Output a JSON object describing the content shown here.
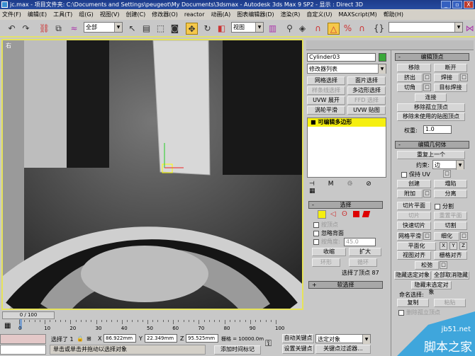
{
  "window": {
    "title": "jc.max   - 项目文件夹: C:\\Documents and Settings\\peugeot\\My Documents\\3dsmax    - Autodesk 3ds Max 9 SP2    - 显示 : Direct 3D",
    "buttons": [
      "_",
      "▫",
      "X"
    ]
  },
  "menu": [
    "文件(F)",
    "编辑(E)",
    "工具(T)",
    "组(G)",
    "视图(V)",
    "创建(C)",
    "修改器(O)",
    "reactor",
    "动画(A)",
    "图表编辑器(D)",
    "渲染(R)",
    "自定义(U)",
    "MAXScript(M)",
    "帮助(H)"
  ],
  "toolbar": {
    "selection_filter": "全部",
    "ref_coord": "视图",
    "named_sel": ""
  },
  "viewport": {
    "label": "右"
  },
  "command_panel": {
    "object_name": "Cylinder03",
    "object_color": "#3aa83a",
    "modifier_list": "修改器列表",
    "modifier_buttons": [
      {
        "label": "网格选择",
        "enabled": true
      },
      {
        "label": "面片选择",
        "enabled": true
      },
      {
        "label": "样条线选择",
        "enabled": false
      },
      {
        "label": "多边形选择",
        "enabled": true
      },
      {
        "label": "UVW 展开",
        "enabled": true
      },
      {
        "label": "FFD 选择",
        "enabled": false
      },
      {
        "label": "涡轮平滑",
        "enabled": true
      },
      {
        "label": "UVW 贴图",
        "enabled": true
      }
    ],
    "stack_item": "可编辑多边形",
    "selection": {
      "title": "选择",
      "by_vertex": "按顶点",
      "ignore_backfacing": "忽略背面",
      "by_angle": "按角度:",
      "angle_value": "45.0",
      "shrink": "收缩",
      "grow": "扩大",
      "ring": "环形",
      "loop": "循环",
      "status": "选择了顶点 87"
    },
    "soft_selection": {
      "title": "软选择"
    },
    "edit_vertices": {
      "title": "编辑顶点",
      "buttons": [
        "移除",
        "断开",
        "挤出",
        "焊接",
        "切角",
        "目标焊接",
        "连接",
        "移除孤立顶点",
        "移除未使用的贴图顶点"
      ],
      "weight_label": "权重:",
      "weight_value": "1.0"
    },
    "edit_geometry": {
      "title": "编辑几何体",
      "repeat": "重复上一个",
      "constraint_label": "约束:",
      "constraint_value": "边",
      "preserve_uv": "保持 UV",
      "create": "创建",
      "collapse": "塌陷",
      "attach": "附加",
      "detach": "分离",
      "slice_plane": "切片平面",
      "split": "分割",
      "slice": "切片",
      "reset_plane": "重置平面",
      "quickslice": "快速切片",
      "cut": "切割",
      "meshsmooth": "网格平滑",
      "tessellate": "细化",
      "make_planar": "平面化",
      "x": "X",
      "y": "Y",
      "z": "Z",
      "view_align": "视图对齐",
      "grid_align": "栅格对齐",
      "relax": "松弛",
      "hide_selected": "隐藏选定对象",
      "unhide_all": "全部取消隐藏",
      "hide_unselected": "隐藏未选定对象",
      "named_sel": "命名选择:",
      "copy": "复制",
      "paste": "粘贴",
      "delete_isolated": "删除孤立顶点"
    }
  },
  "timeline": {
    "slider": "0 / 100",
    "ticks": [
      "0",
      "10",
      "20",
      "30",
      "40",
      "50",
      "60",
      "70",
      "80",
      "90",
      "100"
    ]
  },
  "status": {
    "selected": "选择了 1",
    "x_label": "X",
    "x": "86.922mm",
    "y_label": "Y",
    "y": "22.349mm",
    "z_label": "Z",
    "z": "95.525mm",
    "grid": "栅格 = 10000.0m",
    "prompt": "单击或单击并拖动以选择对象",
    "add_tag": "添加时间标记",
    "auto_key": "自动关键点",
    "set_key": "设置关键点",
    "key_mode": "选定对象",
    "key_filters": "关键点过滤器..."
  },
  "watermark": {
    "site": "jb51.net",
    "name": "脚本之家"
  }
}
